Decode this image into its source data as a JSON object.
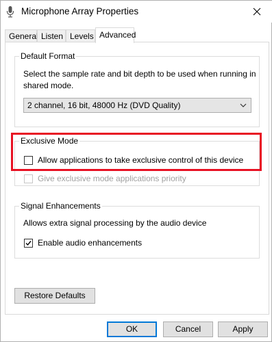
{
  "window": {
    "title": "Microphone Array Properties"
  },
  "tabs": [
    {
      "label": "General"
    },
    {
      "label": "Listen"
    },
    {
      "label": "Levels"
    },
    {
      "label": "Advanced"
    }
  ],
  "default_format": {
    "legend": "Default Format",
    "description": "Select the sample rate and bit depth to be used when running in shared mode.",
    "description_line1": "Select the sample rate and bit depth to be used when running in",
    "description_line2": "shared mode.",
    "selected": "2 channel, 16 bit, 48000 Hz (DVD Quality)"
  },
  "exclusive_mode": {
    "legend": "Exclusive Mode",
    "allow_label": "Allow applications to take exclusive control of this device",
    "allow_checked": false,
    "priority_label": "Give exclusive mode applications priority",
    "priority_checked": false,
    "priority_disabled": true
  },
  "signal_enhancements": {
    "legend": "Signal Enhancements",
    "description": "Allows extra signal processing by the audio device",
    "enable_label": "Enable audio enhancements",
    "enable_checked": true
  },
  "buttons": {
    "restore_defaults": "Restore Defaults",
    "ok": "OK",
    "cancel": "Cancel",
    "apply": "Apply"
  },
  "colors": {
    "highlight": "#e81123",
    "default_button_border": "#0078d7"
  }
}
